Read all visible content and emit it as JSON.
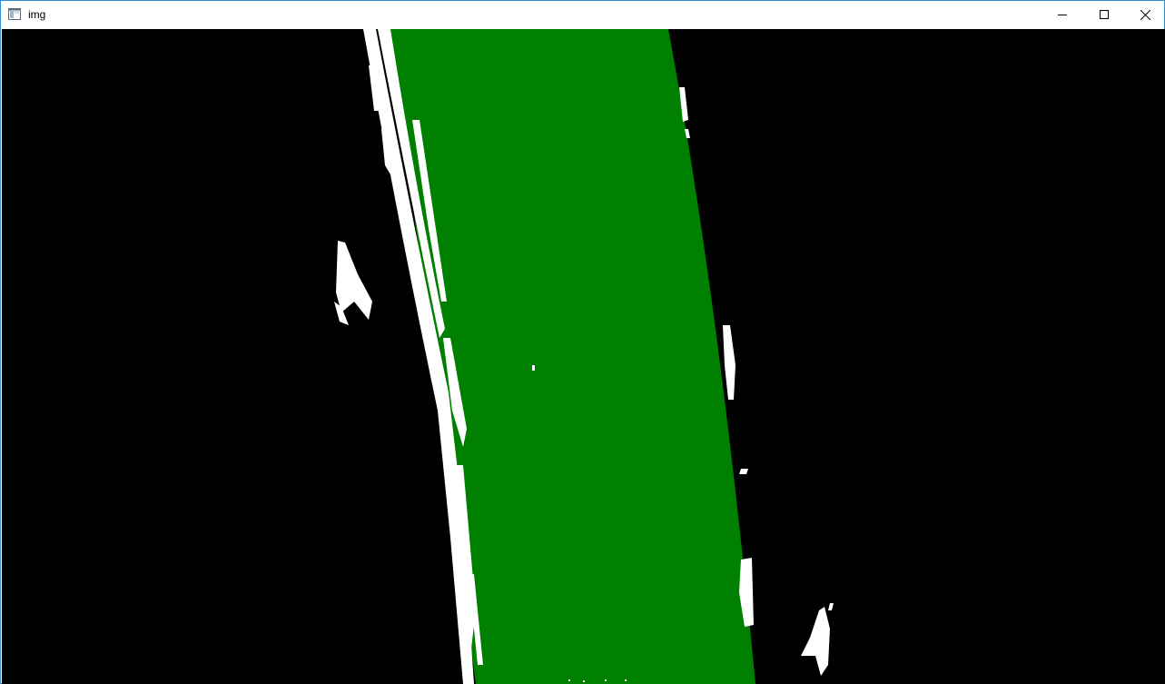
{
  "window": {
    "title": "img",
    "app_icon": "opencv-window-icon",
    "controls": {
      "minimize": "minimize-icon",
      "maximize": "maximize-icon",
      "close": "close-icon"
    }
  },
  "image": {
    "description_colors": {
      "background": "#000000",
      "lane_fill": "#008000",
      "lane_markings": "#ffffff"
    }
  }
}
